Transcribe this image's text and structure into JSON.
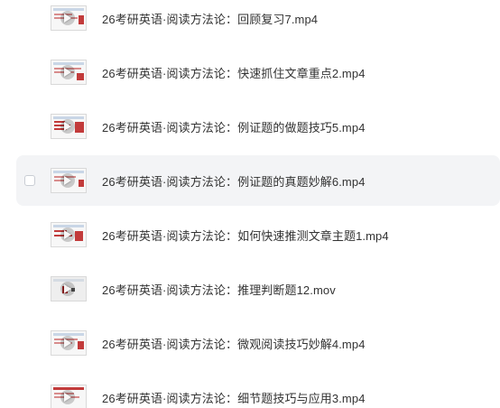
{
  "files": [
    {
      "name": "26考研英语·阅读方法论：回顾复习7.mp4",
      "icon": "video-thumbnail-icon"
    },
    {
      "name": "26考研英语·阅读方法论：快速抓住文章重点2.mp4",
      "icon": "video-thumbnail-icon"
    },
    {
      "name": "26考研英语·阅读方法论：例证题的做题技巧5.mp4",
      "icon": "video-thumbnail-icon"
    },
    {
      "name": "26考研英语·阅读方法论：例证题的真题妙解6.mp4",
      "icon": "video-thumbnail-icon",
      "hovered": true
    },
    {
      "name": "26考研英语·阅读方法论：如何快速推测文章主题1.mp4",
      "icon": "video-thumbnail-icon"
    },
    {
      "name": "26考研英语·阅读方法论：推理判断题12.mov",
      "icon": "video-thumbnail-icon"
    },
    {
      "name": "26考研英语·阅读方法论：微观阅读技巧妙解4.mp4",
      "icon": "video-thumbnail-icon"
    },
    {
      "name": "26考研英语·阅读方法论：细节题技巧与应用3.mp4",
      "icon": "video-thumbnail-icon"
    }
  ]
}
